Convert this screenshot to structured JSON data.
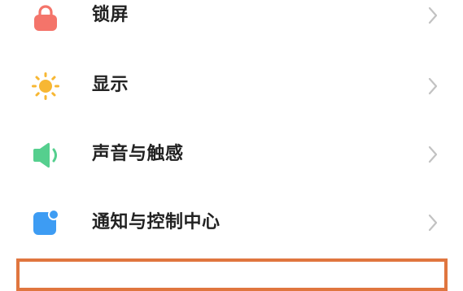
{
  "settings": {
    "items": [
      {
        "label": "锁屏",
        "icon": "lock-icon",
        "icon_color": "#f4746a"
      },
      {
        "label": "显示",
        "icon": "sun-icon",
        "icon_color": "#f7b733"
      },
      {
        "label": "声音与触感",
        "icon": "speaker-icon",
        "icon_color": "#55cf8e"
      },
      {
        "label": "通知与控制中心",
        "icon": "notification-icon",
        "icon_color": "#3d9cf3"
      }
    ]
  },
  "colors": {
    "label_text": "#222222",
    "chevron": "#c2c2c2",
    "highlight_border": "#e0763f",
    "background": "#ffffff"
  }
}
